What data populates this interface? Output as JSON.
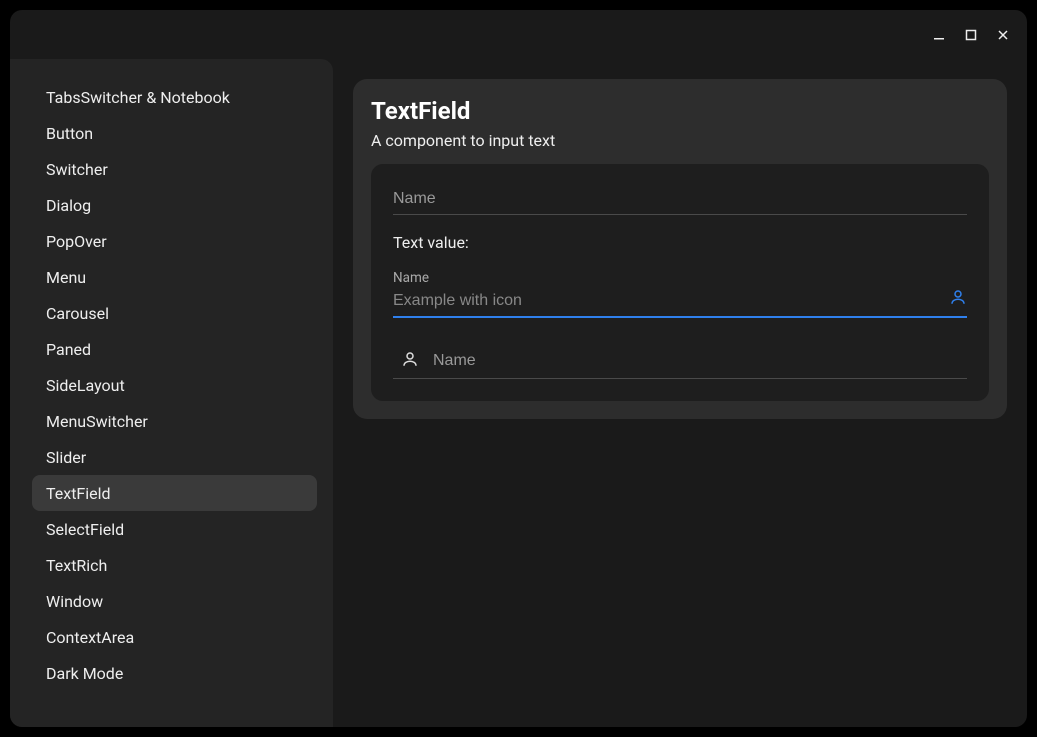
{
  "sidebar": {
    "items": [
      {
        "label": "TabsSwitcher & Notebook",
        "active": false
      },
      {
        "label": "Button",
        "active": false
      },
      {
        "label": "Switcher",
        "active": false
      },
      {
        "label": "Dialog",
        "active": false
      },
      {
        "label": "PopOver",
        "active": false
      },
      {
        "label": "Menu",
        "active": false
      },
      {
        "label": "Carousel",
        "active": false
      },
      {
        "label": "Paned",
        "active": false
      },
      {
        "label": "SideLayout",
        "active": false
      },
      {
        "label": "MenuSwitcher",
        "active": false
      },
      {
        "label": "Slider",
        "active": false
      },
      {
        "label": "TextField",
        "active": true
      },
      {
        "label": "SelectField",
        "active": false
      },
      {
        "label": "TextRich",
        "active": false
      },
      {
        "label": "Window",
        "active": false
      },
      {
        "label": "ContextArea",
        "active": false
      },
      {
        "label": "Dark Mode",
        "active": false
      }
    ]
  },
  "main": {
    "title": "TextField",
    "subtitle": "A component to input text",
    "field1": {
      "placeholder": "Name",
      "value": ""
    },
    "value_label": "Text value:",
    "field2": {
      "label": "Name",
      "placeholder": "Example with icon",
      "value": ""
    },
    "field3": {
      "placeholder": "Name",
      "value": ""
    }
  },
  "icons": {
    "person": "person-icon",
    "person_outline": "person-outline-icon"
  },
  "colors": {
    "accent": "#2f80ed",
    "bg_outer": "#1a1a1a",
    "bg_sidebar": "#242424",
    "bg_card": "#2d2d2d",
    "bg_panel": "#1e1e1e"
  }
}
